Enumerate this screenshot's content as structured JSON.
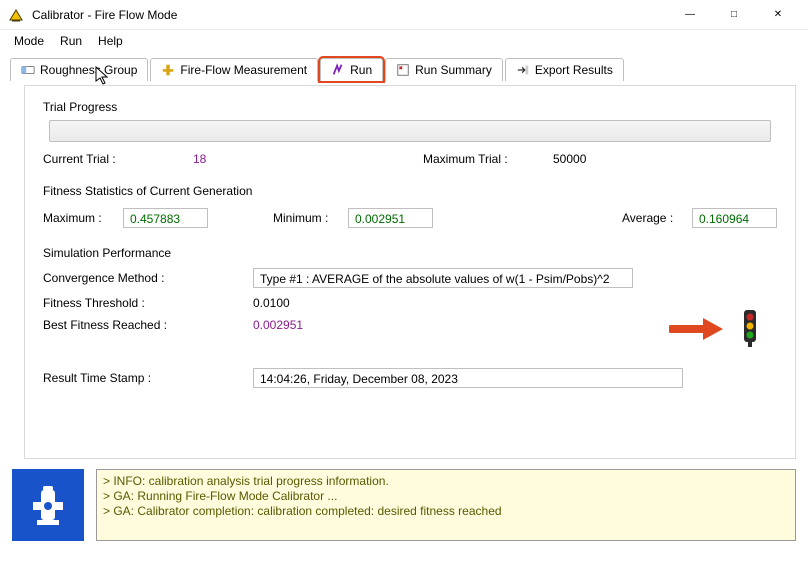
{
  "window": {
    "title": "Calibrator - Fire Flow Mode"
  },
  "menu": {
    "mode": "Mode",
    "run": "Run",
    "help": "Help"
  },
  "tabs": {
    "roughness": "Roughness Group",
    "fireflow": "Fire-Flow Measurement",
    "run": "Run",
    "summary": "Run Summary",
    "export": "Export Results"
  },
  "trial": {
    "section_title": "Trial Progress",
    "current_label": "Current Trial :",
    "current_value": "18",
    "max_label": "Maximum Trial :",
    "max_value": "50000"
  },
  "fitness": {
    "section_title": "Fitness Statistics of Current Generation",
    "max_label": "Maximum :",
    "max_value": "0.457883",
    "min_label": "Minimum :",
    "min_value": "0.002951",
    "avg_label": "Average :",
    "avg_value": "0.160964"
  },
  "sim": {
    "section_title": "Simulation Performance",
    "convergence_label": "Convergence Method :",
    "convergence_value": "Type #1 :   AVERAGE of the absolute values of w(1 - Psim/Pobs)^2",
    "threshold_label": "Fitness Threshold :",
    "threshold_value": "0.0100",
    "best_label": "Best Fitness Reached :",
    "best_value": "0.002951",
    "timestamp_label": "Result Time Stamp :",
    "timestamp_value": "14:04:26, Friday, December 08, 2023"
  },
  "log": {
    "line1": "INFO: calibration analysis trial progress information.",
    "line2": "GA: Running Fire-Flow Mode Calibrator ...",
    "line3": "GA: Calibrator completion: calibration completed: desired fitness reached"
  }
}
